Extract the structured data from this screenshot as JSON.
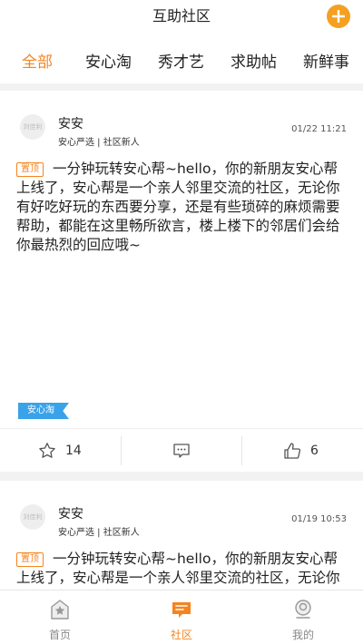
{
  "header": {
    "title": "互助社区",
    "add_icon": "plus-circle-icon"
  },
  "tabs": [
    "全部",
    "安心淘",
    "秀才艺",
    "求助帖",
    "新鲜事"
  ],
  "posts": [
    {
      "avatar_text": "刘佳利",
      "author": "安安",
      "meta": "安心严选 | 社区新人",
      "time": "01/22 11:21",
      "pin": "置顶",
      "text": "一分钟玩转安心帮~hello，你的新朋友安心帮上线了，安心帮是一个亲人邻里交流的社区，无论你有好吃好玩的东西要分享，还是有些琐碎的麻烦需要帮助，都能在这里畅所欲言，楼上楼下的邻居们会给你最热烈的回应哦~",
      "tag": "安心淘",
      "likes": "14",
      "thumbs": "6"
    },
    {
      "avatar_text": "刘佳利",
      "author": "安安",
      "meta": "安心严选 | 社区新人",
      "time": "01/19 10:53",
      "pin": "置顶",
      "text": "一分钟玩转安心帮~hello，你的新朋友安心帮上线了，安心帮是一个亲人邻里交流的社区，无论你有好吃好玩的东西要分享，还是有些"
    }
  ],
  "bottom_nav": [
    {
      "label": "首页"
    },
    {
      "label": "社区"
    },
    {
      "label": "我的"
    }
  ],
  "colors": {
    "accent": "#f5841f",
    "tag_blue": "#3aa2e8"
  }
}
